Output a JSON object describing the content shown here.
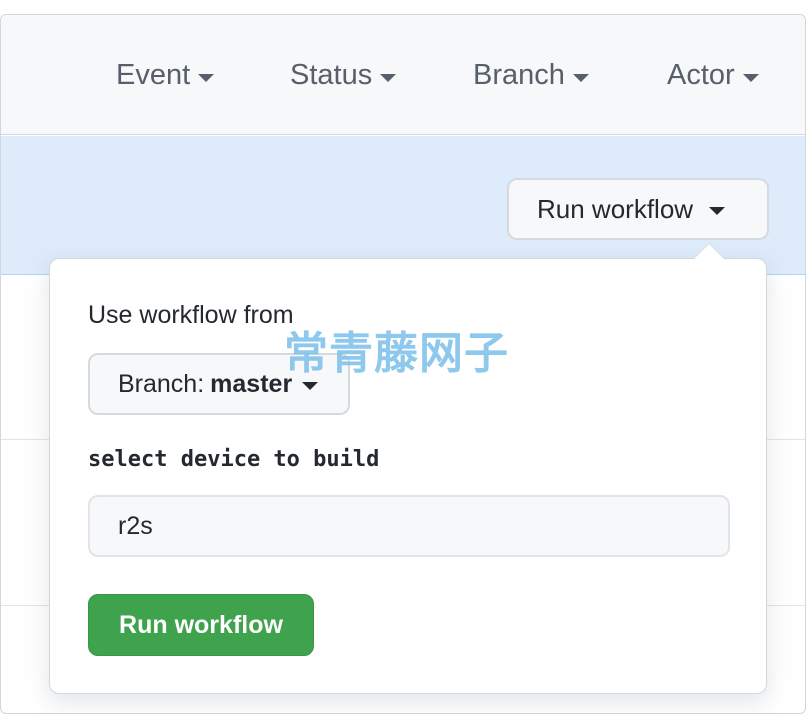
{
  "filters": {
    "event": "Event",
    "status": "Status",
    "branch": "Branch",
    "actor": "Actor"
  },
  "banner": {
    "run_workflow_label": "Run workflow"
  },
  "popover": {
    "use_workflow_from": "Use workflow from",
    "branch_prefix": "Branch:",
    "branch_name": "master",
    "input_label": "select device to build",
    "input_value": "r2s",
    "submit_label": "Run workflow"
  },
  "watermark": "常青藤网子",
  "colors": {
    "primary_green": "#3fa34d",
    "banner_blue": "#ddebfa",
    "text": "#24292f",
    "muted": "#57606a"
  }
}
